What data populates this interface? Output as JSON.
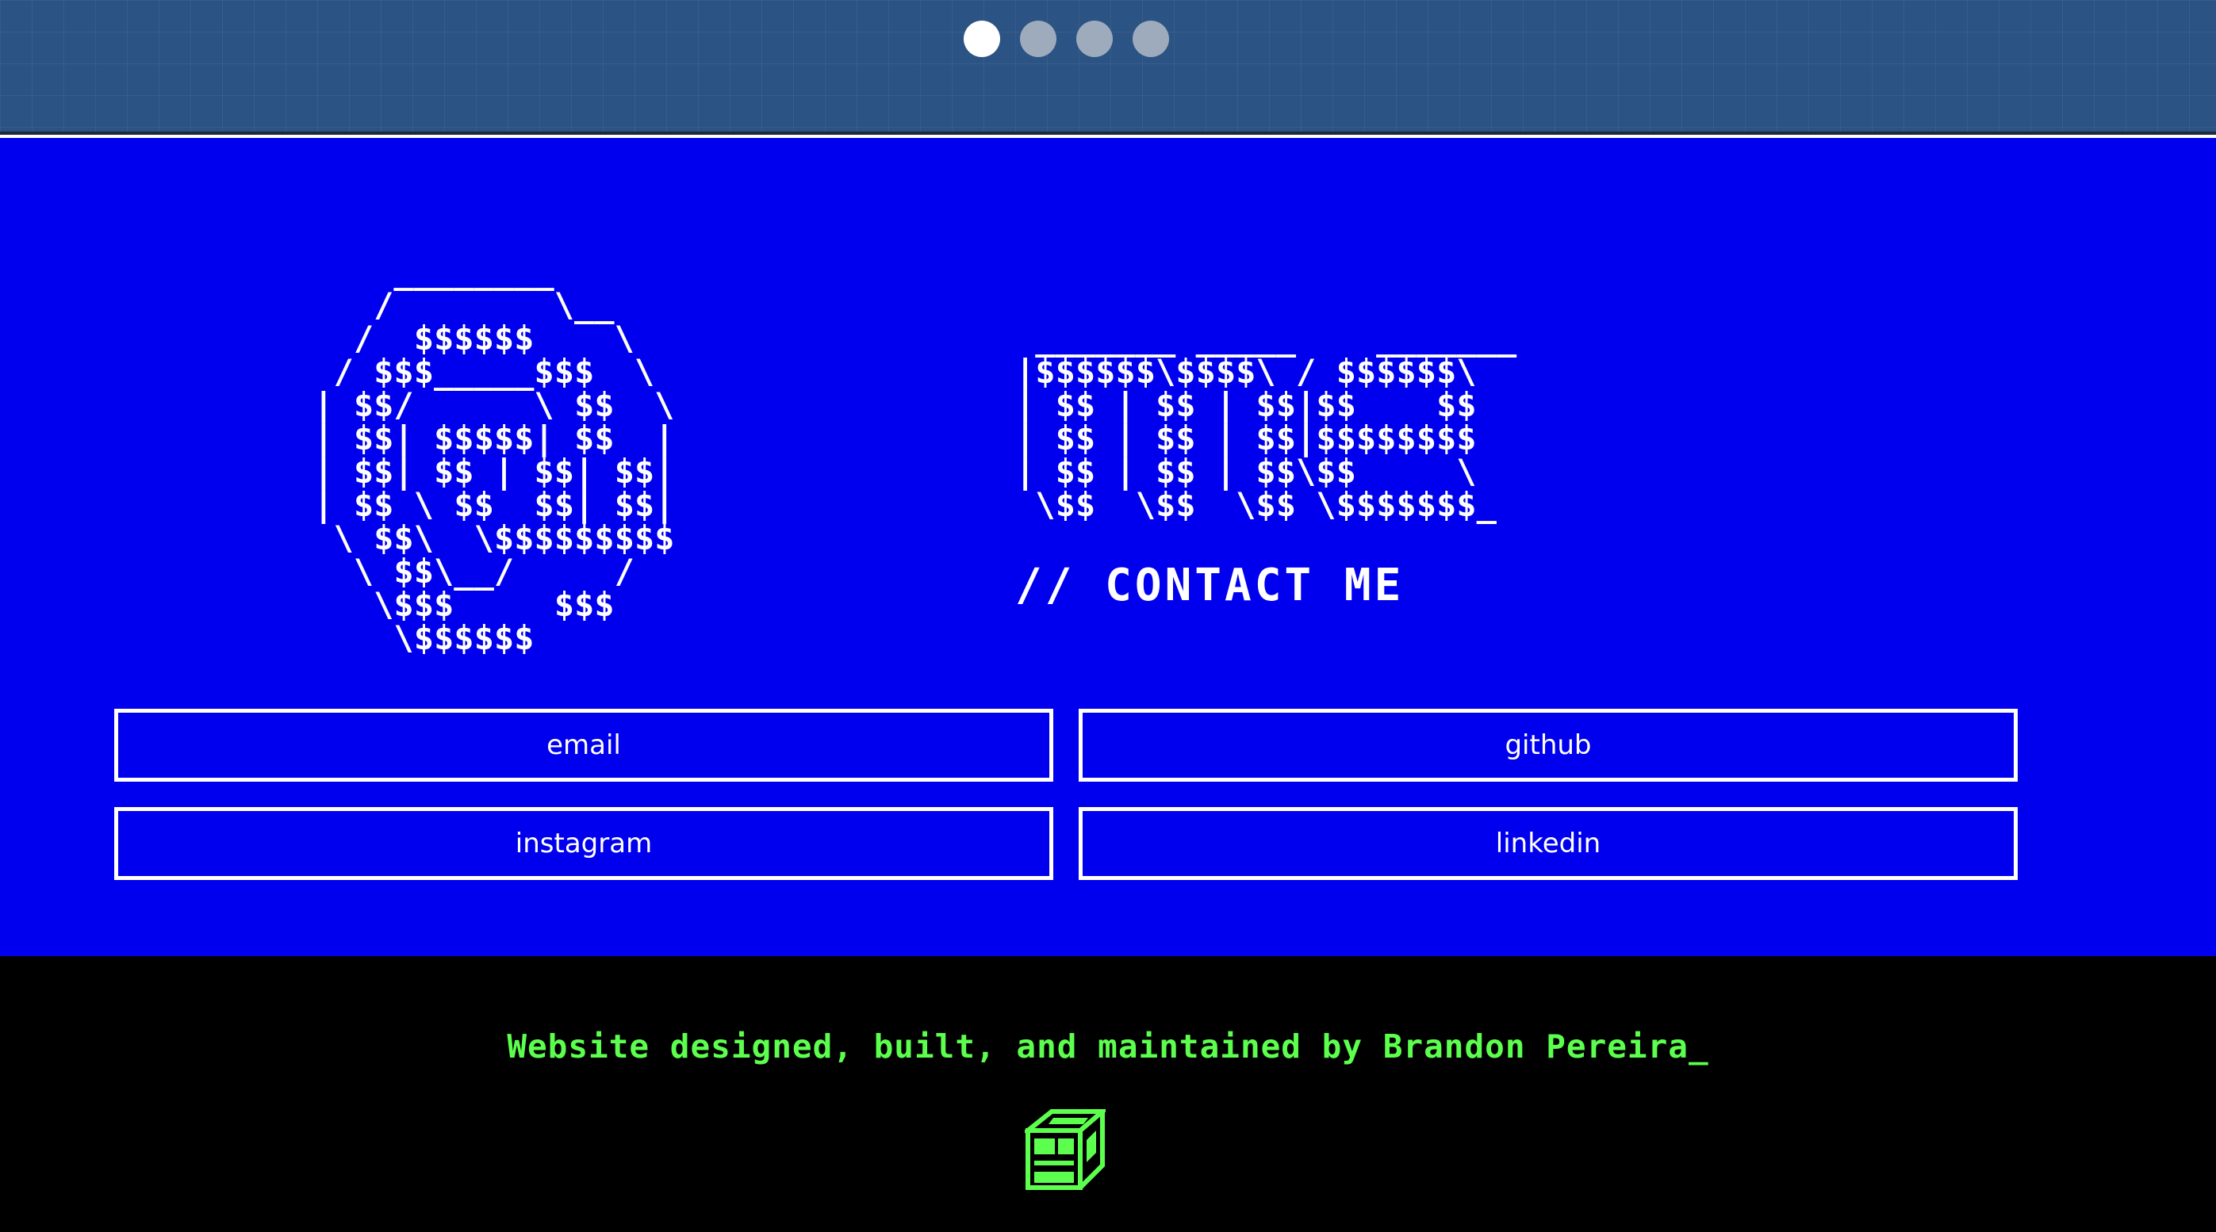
{
  "carousel": {
    "dots": [
      {
        "label": "slide 1",
        "active": true
      },
      {
        "label": "slide 2",
        "active": false
      },
      {
        "label": "slide 3",
        "active": false
      },
      {
        "label": "slide 4",
        "active": false
      }
    ]
  },
  "contact": {
    "ascii_at": "     ________\n    /        \\__\n   /  $$$$$$    \\\n  / $$$_____$$$  \\\n | $$/      \\ $$  \\\n | $$| $$$$$| $$  |\n | $$| $$ | $$| $$|\n | $$ \\ $$  $$| $$|\n  \\ $$\\  \\$$$$$$$$$\n   \\ $$\\__/     /\n    \\$$$     $$$\n     \\$$$$$$",
    "ascii_me": " _______ _____    _______\n|$$$$$$\\$$$$\\ / $$$$$$\\\n| $$ | $$ | $$|$$    $$\n| $$ | $$ | $$|$$$$$$$$\n| $$ | $$ | $$\\$$     \\\n \\$$  \\$$  \\$$ \\$$$$$$$_",
    "subtitle": "// CONTACT ME",
    "links": [
      {
        "label": "email"
      },
      {
        "label": "github"
      },
      {
        "label": "instagram"
      },
      {
        "label": "linkedin"
      }
    ]
  },
  "footer": {
    "credit": "Website designed, built, and maintained by Brandon Pereira_",
    "logo_icon": "pixel-computer-icon",
    "accent_color": "#5cff4d"
  },
  "colors": {
    "contact_background": "#0000ee",
    "top_bar": "#2b5383",
    "footer_background": "#000000"
  }
}
